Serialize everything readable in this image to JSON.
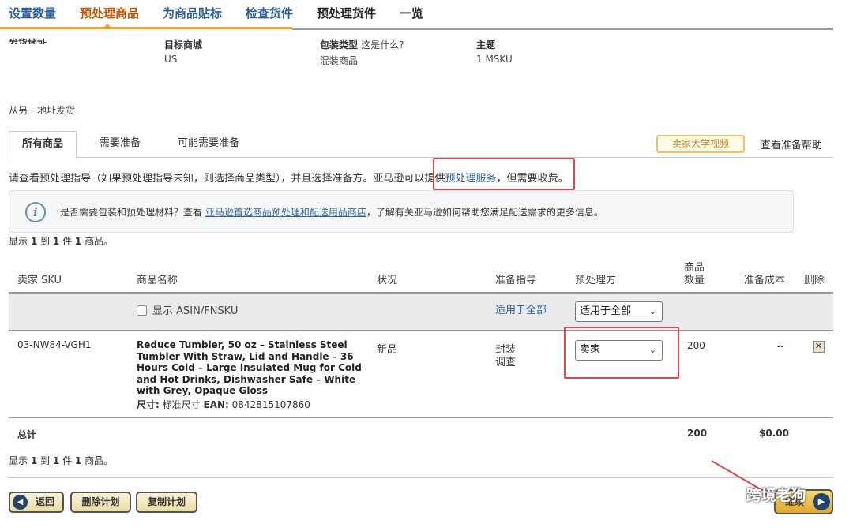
{
  "steps": {
    "items": [
      "设置数量",
      "预处理商品",
      "为商品贴标",
      "检查货件",
      "预处理货件",
      "一览"
    ],
    "active_index": 1
  },
  "info": {
    "ship_from_label": "发货地址",
    "marketplace_label": "目标商城",
    "marketplace_value": "US",
    "packing_label": "包装类型",
    "packing_help": "这是什么?",
    "packing_value": "混装商品",
    "subject_label": "主题",
    "subject_value": "1 MSKU"
  },
  "ship_other": "从另一地址发货",
  "tabs": {
    "all": "所有商品",
    "needs_prep": "需要准备",
    "may_need_prep": "可能需要准备",
    "university_video": "卖家大学视频",
    "prep_help": "查看准备帮助"
  },
  "guide": {
    "text_before": "请查看预处理指导（如果预处理指导未知，则选择商品类型），并且选择准备方。亚马逊可以提供",
    "link": "预处理服务",
    "text_after": "，但需要收费。"
  },
  "alert": {
    "text_before": "是否需要包装和预处理材料？查看",
    "link": "亚马逊首选商品预处理和配送用品商店",
    "text_after": "，了解有关亚马逊如何帮助您满足配送需求的更多信息。"
  },
  "count": {
    "prefix": "显示",
    "from": "1",
    "to_label": "到",
    "to": "1",
    "of_label": "件",
    "total": "1",
    "suffix": "商品。"
  },
  "table": {
    "headers": {
      "sku": "卖家 SKU",
      "name": "商品名称",
      "condition": "状况",
      "prep_guide": "准备指导",
      "prep_owner": "预处理方",
      "qty_line1": "商品",
      "qty_line2": "数量",
      "prep_cost": "准备成本",
      "delete": "删除"
    },
    "apply_all_row": {
      "show_asin_label": "显示 ASIN/FNSKU",
      "apply_all_link": "适用于全部",
      "apply_all_select": "适用于全部"
    },
    "rows": [
      {
        "sku": "03-NW84-VGH1",
        "name": "Reduce Tumbler, 50 oz – Stainless Steel Tumbler With Straw, Lid and Handle – 36 Hours Cold – Large Insulated Mug for Cold and Hot Drinks, Dishwasher Safe – White with Grey, Opaque Gloss",
        "size_label": "尺寸:",
        "size_value": "标准尺寸",
        "ean_label": "EAN:",
        "ean_value": "0842815107860",
        "condition": "新品",
        "prep_guide_line1": "封装",
        "prep_guide_line2": "调查",
        "prep_owner": "卖家",
        "quantity": "200",
        "prep_cost": "--"
      }
    ],
    "total": {
      "label": "总计",
      "quantity": "200",
      "cost": "$0.00"
    }
  },
  "buttons": {
    "back": "返回",
    "delete_plan": "删除计划",
    "copy_plan": "复制计划",
    "continue": "继续"
  },
  "watermark": "跨境老狗",
  "colors": {
    "link": "#2d5f9a",
    "active_step": "#c45500",
    "annotation_red": "#d9474f",
    "button_gold": "#e3a82a"
  }
}
